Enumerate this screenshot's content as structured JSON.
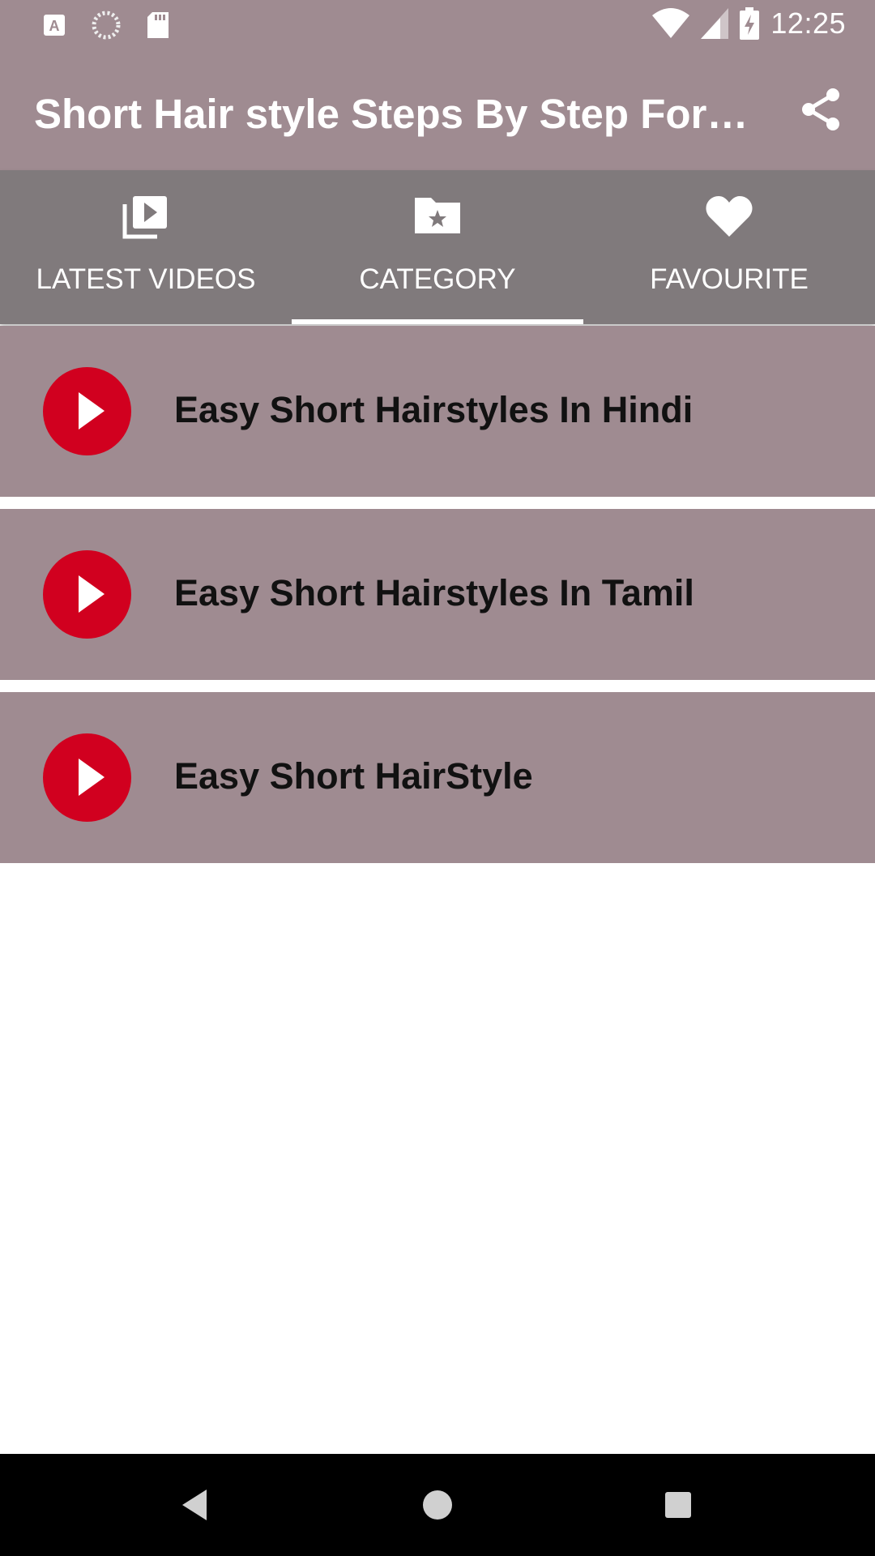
{
  "status_bar": {
    "time": "12:25",
    "icons": [
      "a-notification-icon",
      "sync-icon",
      "sd-card-icon",
      "wifi-icon",
      "signal-icon",
      "battery-charging-icon"
    ]
  },
  "app_bar": {
    "title": "Short Hair style Steps By Step For G…",
    "share_icon": "share-icon"
  },
  "tabs": [
    {
      "label": "LATEST VIDEOS",
      "icon": "video-library-icon",
      "selected": false
    },
    {
      "label": "CATEGORY",
      "icon": "folder-star-icon",
      "selected": true
    },
    {
      "label": "FAVOURITE",
      "icon": "heart-icon",
      "selected": false
    }
  ],
  "categories": [
    {
      "label": "Easy Short Hairstyles In Hindi",
      "icon": "play-icon"
    },
    {
      "label": "Easy Short Hairstyles In Tamil",
      "icon": "play-icon"
    },
    {
      "label": "Easy Short HairStyle",
      "icon": "play-icon"
    }
  ],
  "nav_bar": {
    "buttons": [
      "back-icon",
      "home-icon",
      "recents-icon"
    ]
  },
  "colors": {
    "bar": "#9f8b91",
    "tab_bar": "#807a7c",
    "play_button": "#d1001f",
    "nav": "#000000"
  }
}
